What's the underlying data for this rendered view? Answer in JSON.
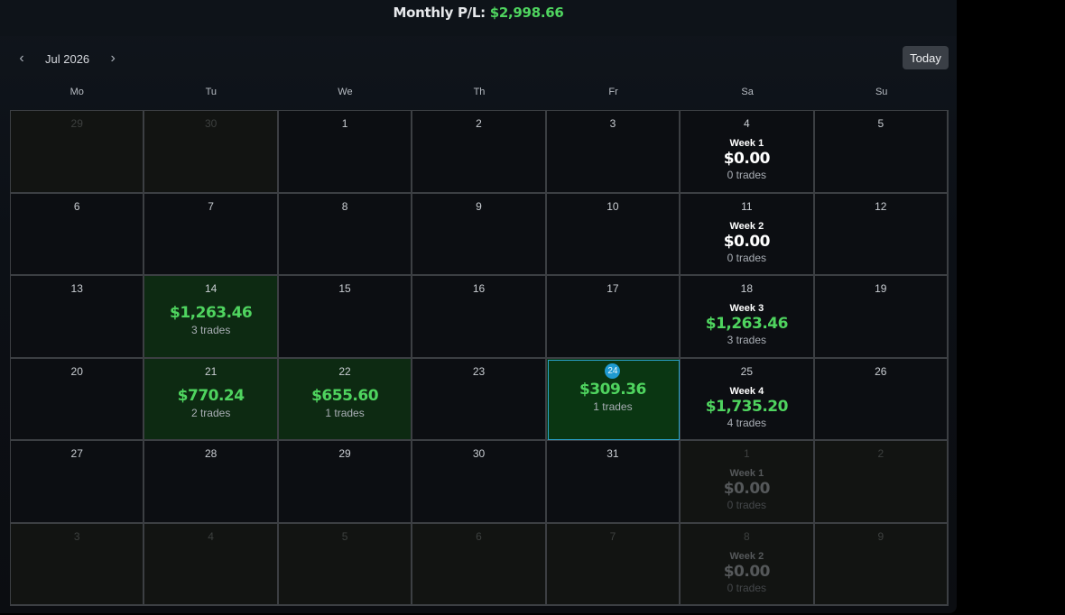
{
  "header": {
    "label": "Monthly P/L:",
    "value": "$2,998.66"
  },
  "nav": {
    "prev": "‹",
    "month": "Jul 2026",
    "next": "›",
    "today": "Today"
  },
  "weekdays": [
    "Mo",
    "Tu",
    "We",
    "Th",
    "Fr",
    "Sa",
    "Su"
  ],
  "weeks": [
    {
      "days": [
        {
          "n": "29",
          "o": true
        },
        {
          "n": "30",
          "o": true
        },
        {
          "n": "1"
        },
        {
          "n": "2"
        },
        {
          "n": "3"
        },
        {
          "n": "4",
          "week": {
            "label": "Week 1",
            "pnl": "$0.00",
            "trades": "0 trades"
          }
        },
        {
          "n": "5"
        }
      ]
    },
    {
      "days": [
        {
          "n": "6"
        },
        {
          "n": "7"
        },
        {
          "n": "8"
        },
        {
          "n": "9"
        },
        {
          "n": "10"
        },
        {
          "n": "11",
          "week": {
            "label": "Week 2",
            "pnl": "$0.00",
            "trades": "0 trades"
          }
        },
        {
          "n": "12"
        }
      ]
    },
    {
      "days": [
        {
          "n": "13"
        },
        {
          "n": "14",
          "pnl": "$1,263.46",
          "trades": "3 trades"
        },
        {
          "n": "15"
        },
        {
          "n": "16"
        },
        {
          "n": "17"
        },
        {
          "n": "18",
          "week": {
            "label": "Week 3",
            "pnl": "$1,263.46",
            "trades": "3 trades",
            "pos": true
          }
        },
        {
          "n": "19"
        }
      ]
    },
    {
      "days": [
        {
          "n": "20"
        },
        {
          "n": "21",
          "pnl": "$770.24",
          "trades": "2 trades"
        },
        {
          "n": "22",
          "pnl": "$655.60",
          "trades": "1 trades"
        },
        {
          "n": "23"
        },
        {
          "n": "24",
          "pnl": "$309.36",
          "trades": "1 trades",
          "today": true
        },
        {
          "n": "25",
          "week": {
            "label": "Week 4",
            "pnl": "$1,735.20",
            "trades": "4 trades",
            "pos": true
          }
        },
        {
          "n": "26"
        }
      ]
    },
    {
      "days": [
        {
          "n": "27"
        },
        {
          "n": "28"
        },
        {
          "n": "29"
        },
        {
          "n": "30"
        },
        {
          "n": "31"
        },
        {
          "n": "1",
          "o": true,
          "week": {
            "label": "Week 1",
            "pnl": "$0.00",
            "trades": "0 trades"
          }
        },
        {
          "n": "2",
          "o": true
        }
      ]
    },
    {
      "days": [
        {
          "n": "3",
          "o": true
        },
        {
          "n": "4",
          "o": true
        },
        {
          "n": "5",
          "o": true
        },
        {
          "n": "6",
          "o": true
        },
        {
          "n": "7",
          "o": true
        },
        {
          "n": "8",
          "o": true,
          "week": {
            "label": "Week 2",
            "pnl": "$0.00",
            "trades": "0 trades"
          }
        },
        {
          "n": "9",
          "o": true
        }
      ]
    }
  ]
}
